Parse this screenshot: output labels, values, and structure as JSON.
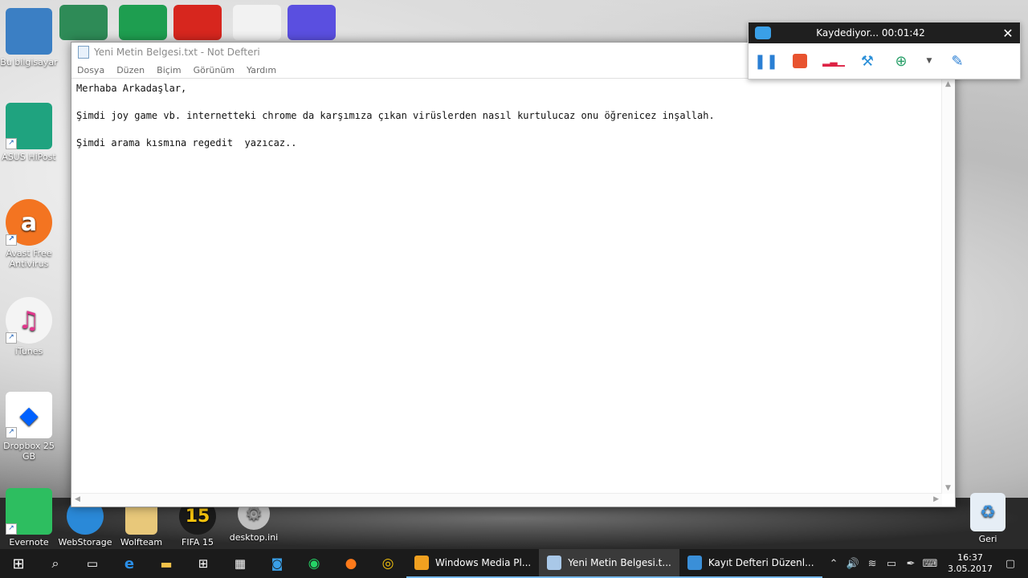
{
  "desktop": {
    "left_icons": [
      {
        "label": "Bu bilgisayar",
        "color": "#3b7fc4"
      },
      {
        "label": "ASUS HiPost",
        "color": "#1fa37f"
      },
      {
        "label": "Avast Free Antivirus",
        "color": "#f37421"
      },
      {
        "label": "iTunes",
        "color": "#f4f4f4"
      },
      {
        "label": "Dropbox 25 GB",
        "color": "#ffffff"
      },
      {
        "label": "Evernote",
        "color": "#2dbe60"
      }
    ],
    "bottom_icons": [
      {
        "label": "WebStorage",
        "color": "#2a89d8"
      },
      {
        "label": "Wolfteam",
        "color": "#e8c87a"
      },
      {
        "label": "FIFA 15",
        "color": "#1a1a1a"
      },
      {
        "label": "desktop.ini",
        "color": "#bfbfbf"
      }
    ],
    "recycle_label": "Geri"
  },
  "notepad": {
    "title": "Yeni Metin Belgesi.txt - Not Defteri",
    "menu": [
      "Dosya",
      "Düzen",
      "Biçim",
      "Görünüm",
      "Yardım"
    ],
    "content": "Merhaba Arkadaşlar,\n\nŞimdi joy game vb. internetteki chrome da karşımıza çıkan virüslerden nasıl kurtulucaz onu öğrenicez inşallah.\n\nŞimdi arama kısmına regedit  yazıcaz.."
  },
  "recorder": {
    "status": "Kaydediyor... 00:01:42",
    "accent": "#e8532f"
  },
  "taskbar": {
    "apps": [
      {
        "label": "Windows Media Pl...",
        "active": false,
        "color": "#f0a020"
      },
      {
        "label": "Yeni Metin Belgesi.t...",
        "active": true,
        "color": "#a9c8e8"
      },
      {
        "label": "Kayıt Defteri Düzenl...",
        "active": false,
        "color": "#3a8fd8"
      }
    ],
    "time": "16:37",
    "date": "3.05.2017"
  }
}
